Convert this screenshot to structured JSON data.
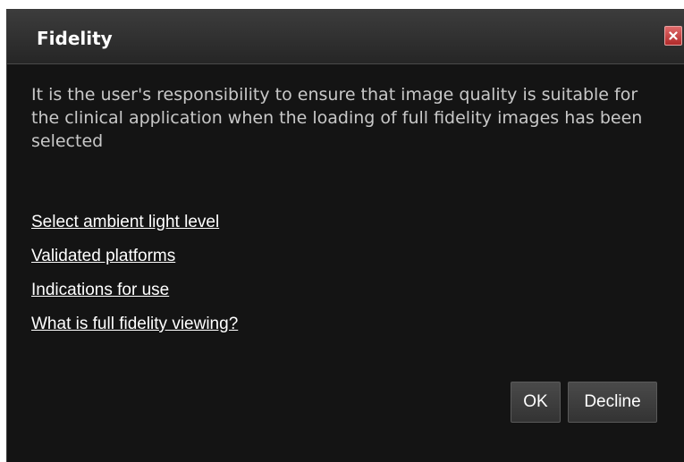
{
  "dialog": {
    "title": "Fidelity",
    "close_icon": "close-x-icon",
    "message": "It is the user's responsibility to ensure that image quality is suitable for the clinical application when the loading of full fidelity images has been selected",
    "links": [
      {
        "label": "Select ambient light level"
      },
      {
        "label": "Validated platforms"
      },
      {
        "label": "Indications for use"
      },
      {
        "label": "What is full fidelity viewing?"
      }
    ],
    "buttons": {
      "ok_label": "OK",
      "decline_label": "Decline"
    },
    "colors": {
      "background": "#141414",
      "close_button": "#c0392b",
      "text": "#c8c8c8",
      "link": "#ffffff"
    }
  }
}
